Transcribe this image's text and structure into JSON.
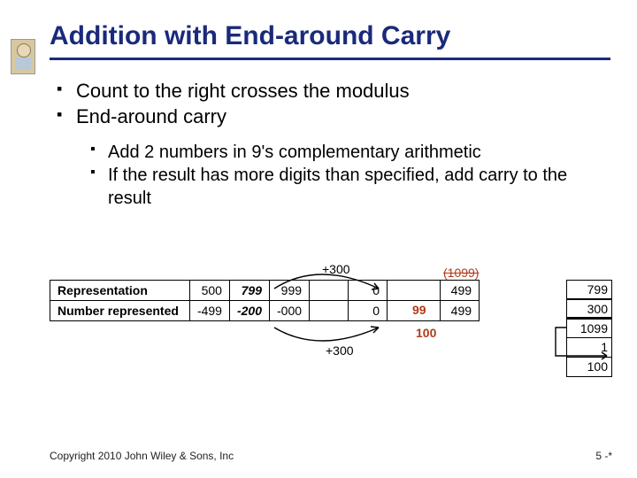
{
  "title": "Addition with End-around Carry",
  "bullets": {
    "b1": "Count to the right crosses the modulus",
    "b2": "End-around carry"
  },
  "sub_bullets": {
    "s1": "Add 2 numbers in 9's complementary arithmetic",
    "s2": "If the result has more digits than specified, add carry to the result"
  },
  "table": {
    "row1_label": "Representation",
    "row2_label": "Number represented",
    "r1": {
      "c1": "500",
      "c2": "799",
      "c3": "999",
      "c4": "",
      "c5": "0",
      "c6": "",
      "c7": "499"
    },
    "r2": {
      "c1": "-499",
      "c2": "-200",
      "c3": "-000",
      "c4": "",
      "c5": "0",
      "c6": "",
      "c7": "499"
    }
  },
  "annotations": {
    "plus300": "+300",
    "ninetynine": "99",
    "hundred": "100",
    "crossed": "(1099)"
  },
  "calc": {
    "a": "799",
    "b": "300",
    "sum": "1099",
    "carry": "1",
    "wrap": "100"
  },
  "footer": {
    "copyright": "Copyright 2010 John Wiley & Sons, Inc",
    "page": "5 -*"
  }
}
